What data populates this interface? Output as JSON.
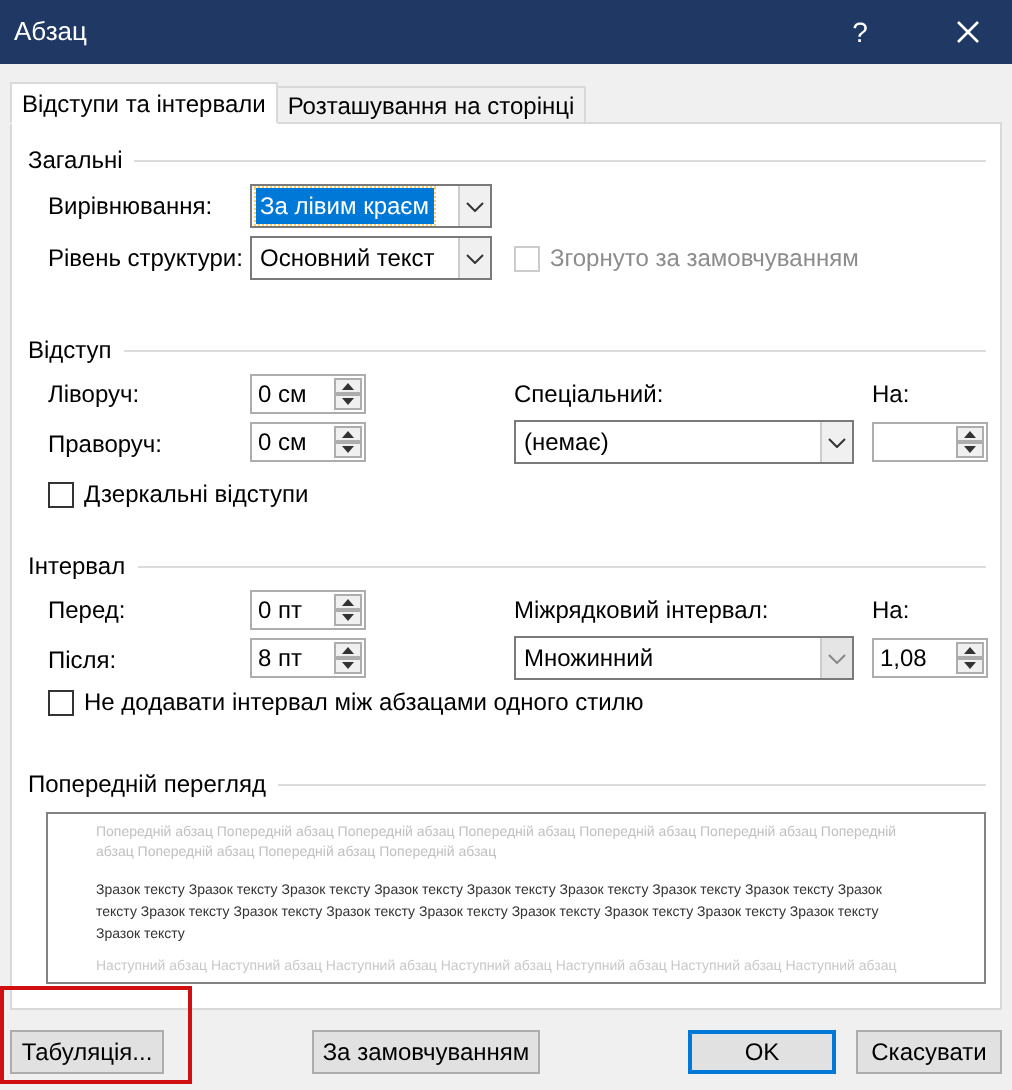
{
  "window": {
    "title": "Абзац",
    "help": "?"
  },
  "tabs": [
    {
      "label": "Відступи та інтервали",
      "selected": true
    },
    {
      "label": "Розташування на сторінці",
      "selected": false
    }
  ],
  "general": {
    "heading": "Загальні",
    "alignment": {
      "label": "Вирівнювання:",
      "value": "За лівим краєм",
      "focused": true
    },
    "outline_level": {
      "label": "Рівень структури:",
      "value": "Основний текст",
      "focused": false
    },
    "collapsed": {
      "label": "Згорнуто за замовчуванням",
      "checked": false,
      "disabled": true
    }
  },
  "indent": {
    "heading": "Відступ",
    "left": {
      "label": "Ліворуч:",
      "value": "0 см"
    },
    "right": {
      "label": "Праворуч:",
      "value": "0 см"
    },
    "special": {
      "label": "Спеціальний:",
      "value": "(немає)",
      "disabled": false
    },
    "by": {
      "label": "На:"
    },
    "mirror": {
      "label": "Дзеркальні відступи",
      "checked": false,
      "disabled": false
    }
  },
  "spacing": {
    "heading": "Інтервал",
    "before": {
      "label": "Перед:",
      "value": "0 пт"
    },
    "after": {
      "label": "Після:",
      "value": "8 пт"
    },
    "line_spacing": {
      "label": "Міжрядковий інтервал:",
      "value": "Множинний",
      "disabled": true
    },
    "at": {
      "label": "На:",
      "value": "1,08"
    },
    "no_space": {
      "label": "Не додавати інтервал між абзацами одного стилю",
      "checked": false,
      "disabled": false
    }
  },
  "preview": {
    "heading": "Попередній перегляд",
    "previous": "Попередній абзац Попередній абзац Попередній абзац Попередній абзац Попередній абзац Попередній абзац Попередній абзац Попередній абзац Попередній абзац Попередній абзац",
    "sample": "Зразок тексту Зразок тексту Зразок тексту Зразок тексту Зразок тексту Зразок тексту Зразок тексту Зразок тексту Зразок тексту Зразок тексту Зразок тексту Зразок тексту Зразок тексту Зразок тексту Зразок тексту Зразок тексту Зразок тексту Зразок тексту",
    "next": "Наступний абзац Наступний абзац Наступний абзац Наступний абзац Наступний абзац Наступний абзац Наступний абзац"
  },
  "buttons": [
    {
      "label": "Табуляція...",
      "default": false,
      "highlighted": true
    },
    {
      "label": "За замовчуванням",
      "default": false,
      "highlighted": false
    },
    {
      "label": "OK",
      "default": true,
      "highlighted": false
    },
    {
      "label": "Скасувати",
      "default": false,
      "highlighted": false
    }
  ]
}
